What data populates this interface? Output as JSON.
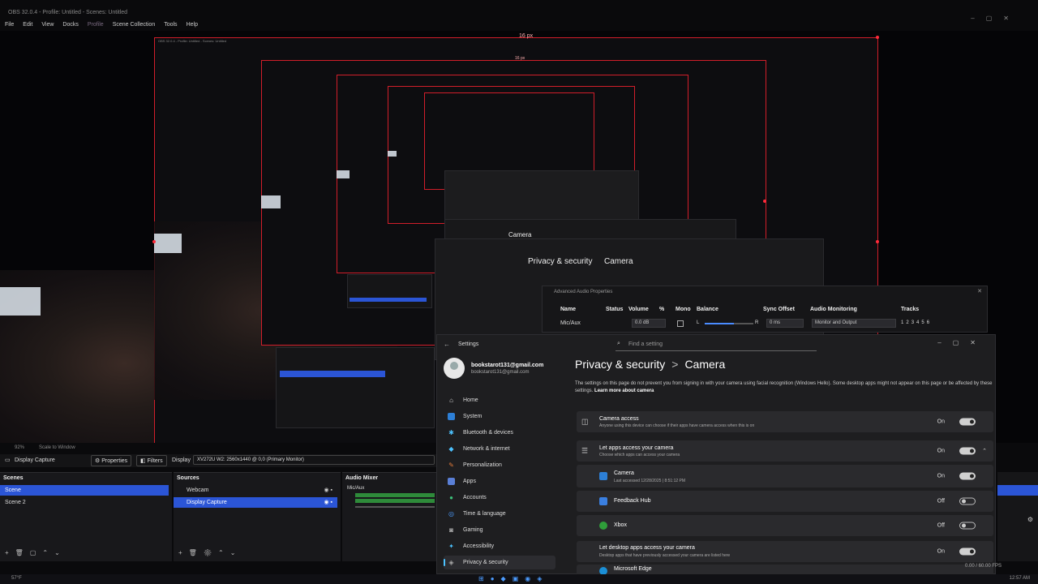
{
  "obs": {
    "title": "OBS 32.0.4 - Profile: Untitled - Scenes: Untitled",
    "menu": [
      "File",
      "Edit",
      "View",
      "Docks",
      "Profile",
      "Scene Collection",
      "Tools",
      "Help"
    ],
    "px_label": "16 px",
    "status": {
      "zoom": "92%",
      "scale": "Scale to Window"
    },
    "toolbar": {
      "source": "Display Capture",
      "properties": "Properties",
      "filters": "Filters",
      "display_label": "Display",
      "display_value": "XV272U W2: 2560x1440 @ 0,0 (Primary Monitor)"
    },
    "scenes": {
      "header": "Scenes",
      "items": [
        "Scene",
        "Scene 2"
      ]
    },
    "sources": {
      "header": "Sources",
      "items": [
        "Webcam",
        "Display Capture"
      ]
    },
    "mixer": {
      "header": "Audio Mixer",
      "channel": "Mic/Aux"
    },
    "right_status": "0.00 / 60.00 FPS"
  },
  "advanced_audio": {
    "title": "Advanced Audio Properties",
    "columns": [
      "Name",
      "Status",
      "Volume",
      "%",
      "Mono",
      "Balance",
      "Sync Offset",
      "Audio Monitoring",
      "Tracks"
    ],
    "row": {
      "name": "Mic/Aux",
      "volume": "0.0 dB",
      "balance_l": "L",
      "balance_r": "R",
      "sync": "0 ms",
      "monitoring": "Monitor and Output",
      "tracks": [
        "1",
        "2",
        "3",
        "4",
        "5",
        "6"
      ]
    }
  },
  "settings": {
    "title": "Settings",
    "search_placeholder": "Find a setting",
    "user": {
      "name": "bookstarot131@gmail.com",
      "email": "bookstarot131@gmail.com"
    },
    "nav": [
      "Home",
      "System",
      "Bluetooth & devices",
      "Network & internet",
      "Personalization",
      "Apps",
      "Accounts",
      "Time & language",
      "Gaming",
      "Accessibility",
      "Privacy & security"
    ],
    "breadcrumb": {
      "parent": "Privacy & security",
      "sep": ">",
      "current": "Camera"
    },
    "description": "The settings on this page do not prevent you from signing in with your camera using facial recognition (Windows Hello). Some desktop apps might not appear on this page or be affected by these settings.",
    "learn_more": "Learn more about camera",
    "camera_access": {
      "title": "Camera access",
      "sub": "Anyone using this device can choose if their apps have camera access when this is on",
      "state": "On"
    },
    "apps_access": {
      "title": "Let apps access your camera",
      "sub": "Choose which apps can access your camera",
      "state": "On"
    },
    "apps": [
      {
        "name": "Camera",
        "sub": "Last accessed 12/28/2025 | 8:51:12 PM",
        "state": "On"
      },
      {
        "name": "Feedback Hub",
        "sub": "",
        "state": "Off"
      },
      {
        "name": "Xbox",
        "sub": "",
        "state": "Off"
      }
    ],
    "desktop_access": {
      "title": "Let desktop apps access your camera",
      "sub": "Desktop apps that have previously accessed your camera are listed here",
      "state": "On"
    },
    "edge": "Microsoft Edge"
  },
  "taskbar": {
    "weather": "57°F",
    "time": "12:57 AM"
  }
}
